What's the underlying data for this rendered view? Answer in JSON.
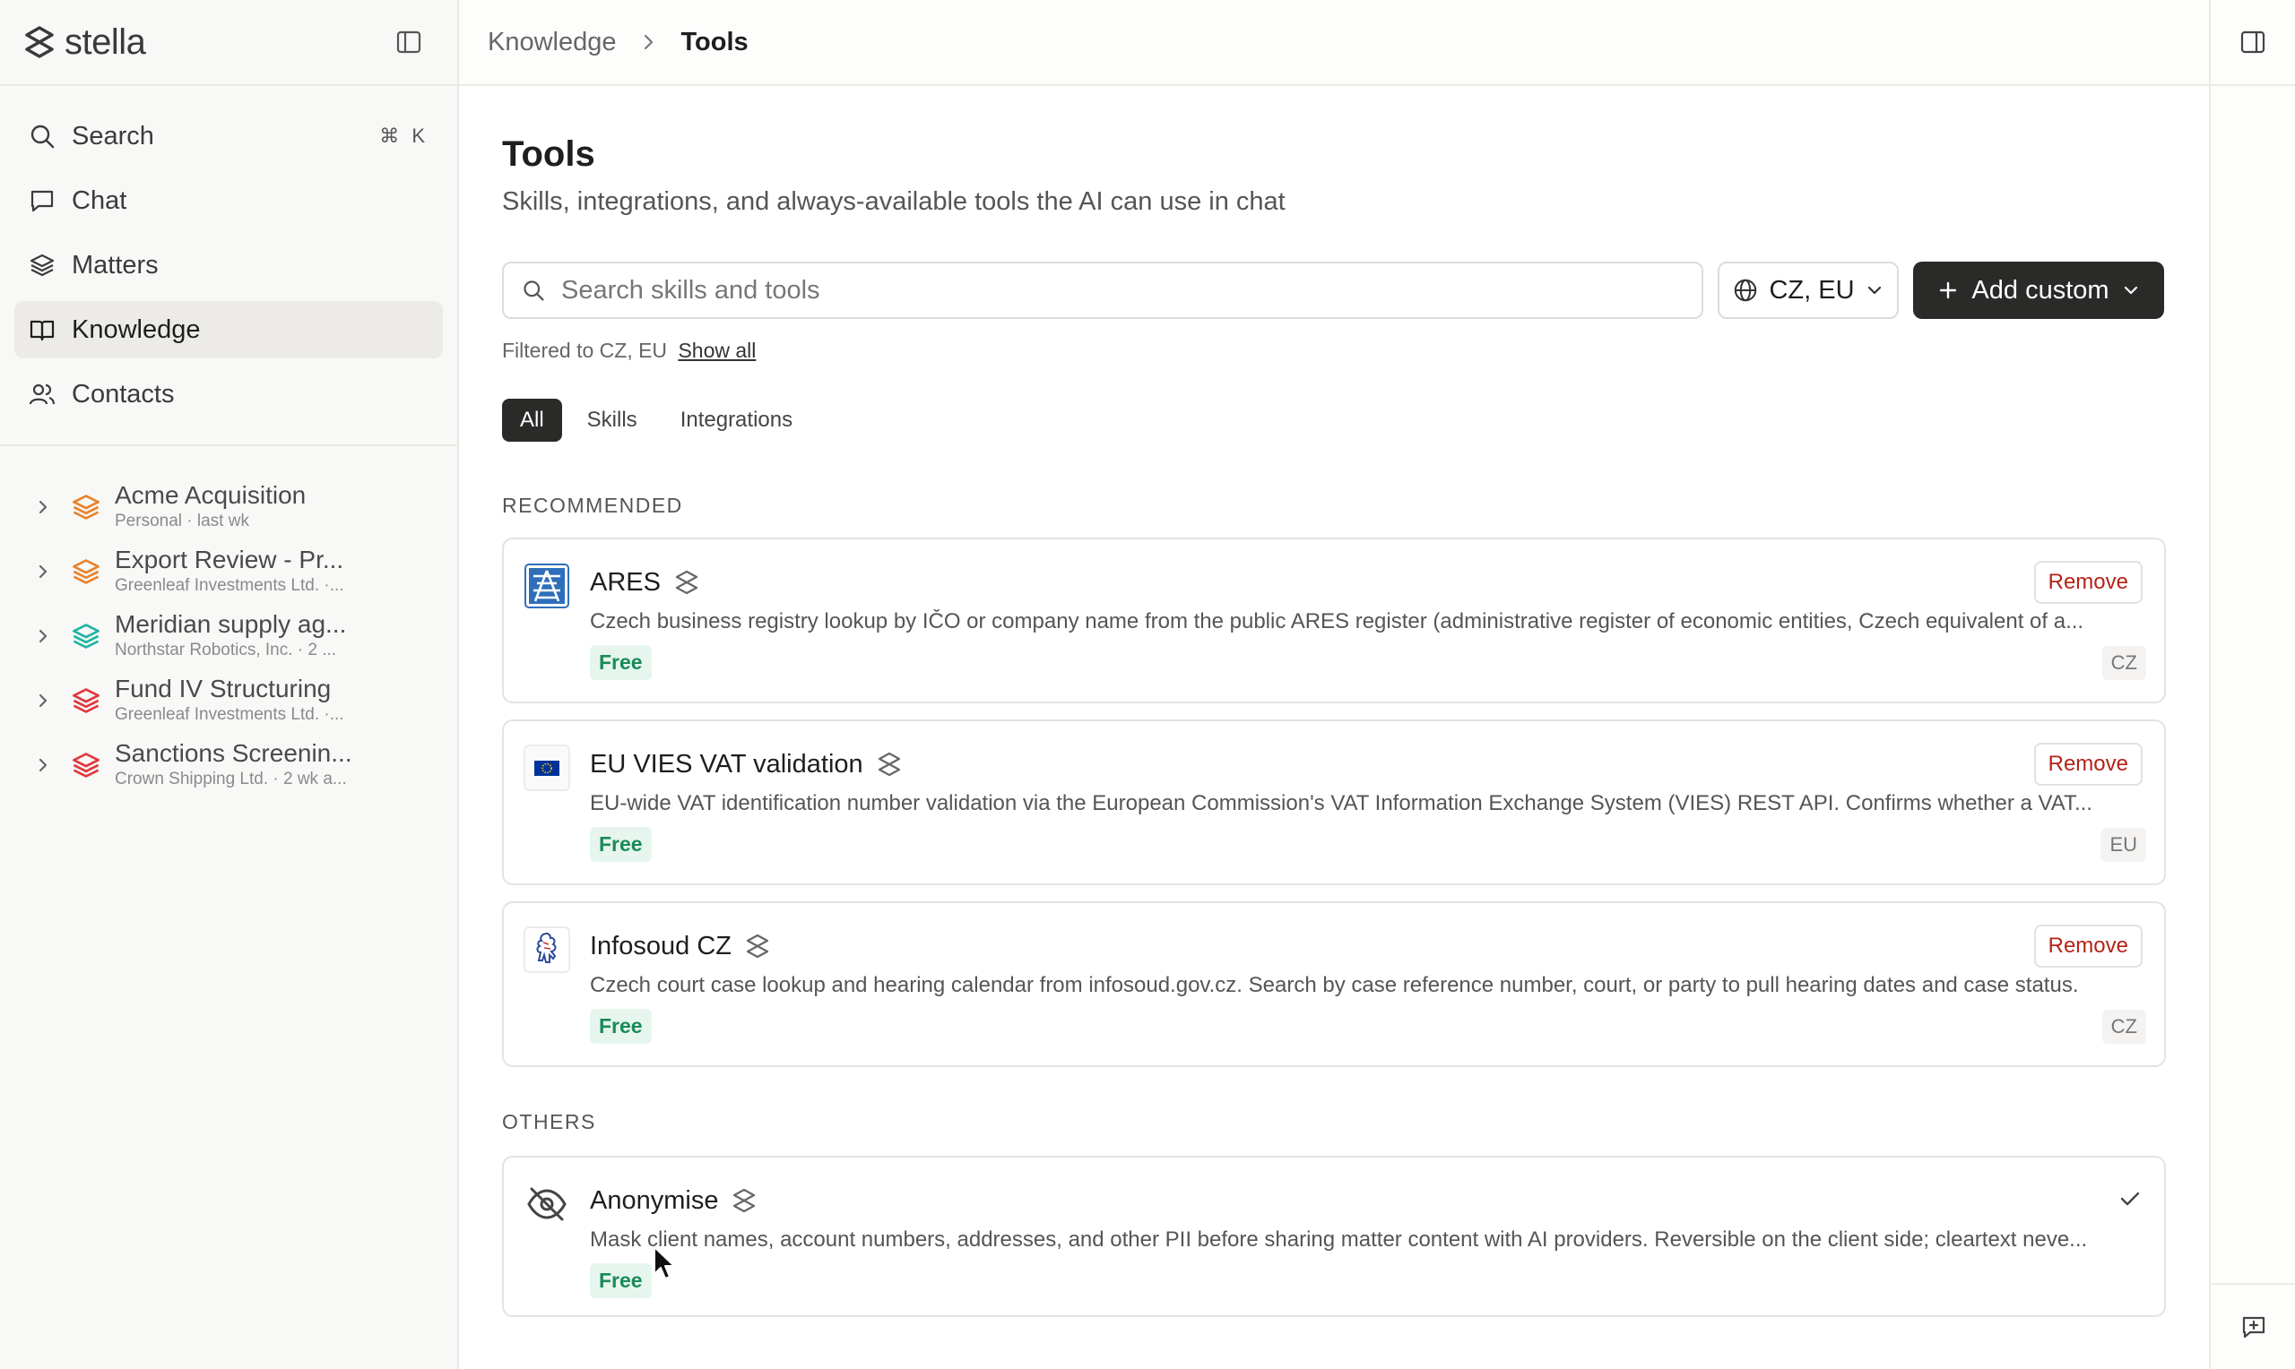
{
  "brand": {
    "name": "stella"
  },
  "nav": {
    "search": {
      "label": "Search",
      "shortcut": "⌘ K"
    },
    "items": [
      {
        "label": "Chat",
        "icon": "chat-icon"
      },
      {
        "label": "Matters",
        "icon": "layers-icon"
      },
      {
        "label": "Knowledge",
        "icon": "book-icon",
        "active": true
      },
      {
        "label": "Contacts",
        "icon": "users-icon"
      }
    ]
  },
  "matters": [
    {
      "title": "Acme Acquisition",
      "subtitle": "Personal · last wk",
      "color": "#e8842c"
    },
    {
      "title": "Export Review - Pr...",
      "subtitle": "Greenleaf Investments Ltd. ·...",
      "color": "#e8842c"
    },
    {
      "title": "Meridian supply ag...",
      "subtitle": "Northstar Robotics, Inc. · 2 ...",
      "color": "#1fb5a4"
    },
    {
      "title": "Fund IV Structuring",
      "subtitle": "Greenleaf Investments Ltd. ·...",
      "color": "#e0383e"
    },
    {
      "title": "Sanctions Screenin...",
      "subtitle": "Crown Shipping Ltd. · 2 wk a...",
      "color": "#e0383e"
    }
  ],
  "breadcrumb": {
    "parent": "Knowledge",
    "current": "Tools"
  },
  "page": {
    "title": "Tools",
    "subtitle": "Skills, integrations, and always-available tools the AI can use in chat"
  },
  "search": {
    "placeholder": "Search skills and tools",
    "value": ""
  },
  "region_filter": {
    "label": "CZ, EU"
  },
  "add_button": {
    "label": "Add custom"
  },
  "filter_note": {
    "text": "Filtered to CZ, EU",
    "link": "Show all"
  },
  "tabs": [
    {
      "label": "All",
      "active": true
    },
    {
      "label": "Skills",
      "active": false
    },
    {
      "label": "Integrations",
      "active": false
    }
  ],
  "sections": {
    "recommended": "RECOMMENDED",
    "others": "OTHERS"
  },
  "recommended": [
    {
      "name": "ARES",
      "description": "Czech business registry lookup by IČO or company name from the public ARES register (administrative register of economic entities, Czech equivalent of a...",
      "price": "Free",
      "region": "CZ",
      "action": "Remove",
      "logo": "ares-logo"
    },
    {
      "name": "EU VIES VAT validation",
      "description": "EU-wide VAT identification number validation via the European Commission's VAT Information Exchange System (VIES) REST API. Confirms whether a VAT...",
      "price": "Free",
      "region": "EU",
      "action": "Remove",
      "logo": "eu-flag-logo"
    },
    {
      "name": "Infosoud CZ",
      "description": "Czech court case lookup and hearing calendar from infosoud.gov.cz. Search by case reference number, court, or party to pull hearing dates and case status.",
      "price": "Free",
      "region": "CZ",
      "action": "Remove",
      "logo": "czech-lion-logo"
    }
  ],
  "others": [
    {
      "name": "Anonymise",
      "description": "Mask client names, account numbers, addresses, and other PII before sharing matter content with AI providers. Reversible on the client side; cleartext neve...",
      "price": "Free",
      "logo": "eye-off-icon"
    }
  ],
  "colors": {
    "accent_dark": "#2a2a29",
    "remove_red": "#b42318",
    "free_green": "#1a8a57"
  }
}
